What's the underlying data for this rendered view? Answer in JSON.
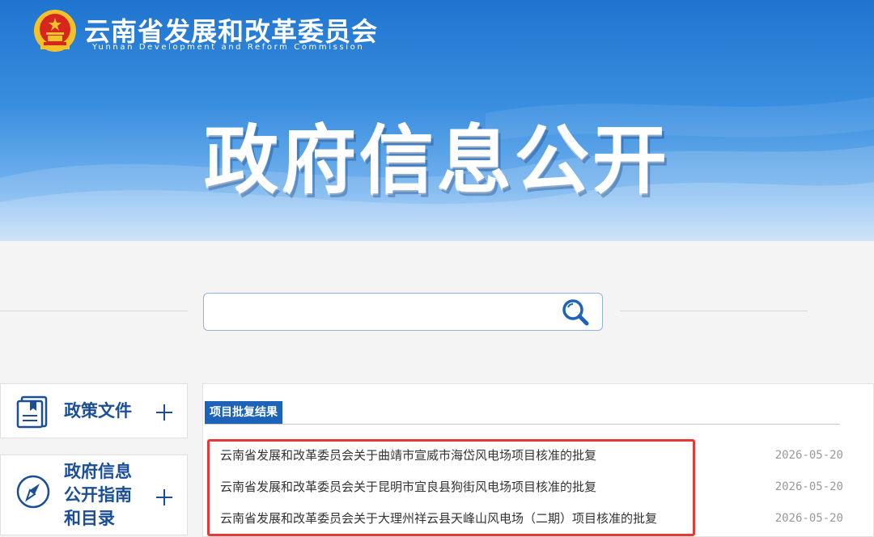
{
  "header": {
    "org_name": "云南省发展和改革委员会",
    "org_name_en": "Yunnan Development and Reform Commission",
    "hero_title": "政府信息公开"
  },
  "search": {
    "placeholder": "",
    "icon": "search-magnifier-icon"
  },
  "sidebar": {
    "items": [
      {
        "label": "政策文件",
        "icon": "document-book-icon",
        "action_icon": "plus-icon"
      },
      {
        "label": "政府信息公开指南和目录",
        "icon": "compass-icon",
        "action_icon": "plus-icon"
      }
    ]
  },
  "main": {
    "section_title": "项目批复结果",
    "items": [
      {
        "title": "云南省发展和改革委员会关于曲靖市宣威市海岱风电场项目核准的批复",
        "date": "2026-05-20"
      },
      {
        "title": "云南省发展和改革委员会关于昆明市宜良县狗街风电场项目核准的批复",
        "date": "2026-05-20"
      },
      {
        "title": "云南省发展和改革委员会关于大理州祥云县天峰山风电场（二期）项目核准的批复",
        "date": "2026-05-20"
      }
    ]
  },
  "colors": {
    "banner_blue": "#1f74cf",
    "nav_text": "#1a4e96",
    "tab_bg": "#1c63b9",
    "highlight_border": "#e53935"
  }
}
